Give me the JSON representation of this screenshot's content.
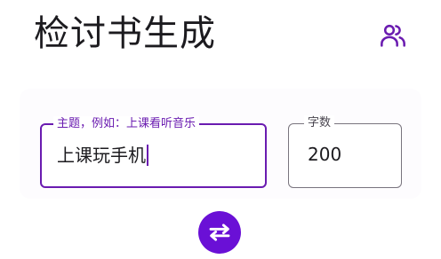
{
  "app": {
    "title": "检讨书生成"
  },
  "header": {
    "account_icon": "people-icon"
  },
  "form": {
    "topic": {
      "label": "主题，例如：上课看听音乐",
      "value": "上课玩手机"
    },
    "word_count": {
      "label": "字数",
      "value": "200"
    }
  },
  "actions": {
    "swap_icon": "swap-arrows-icon"
  },
  "colors": {
    "accent": "#6a1bb0",
    "button": "#6a10d6",
    "outline": "#79747e"
  }
}
